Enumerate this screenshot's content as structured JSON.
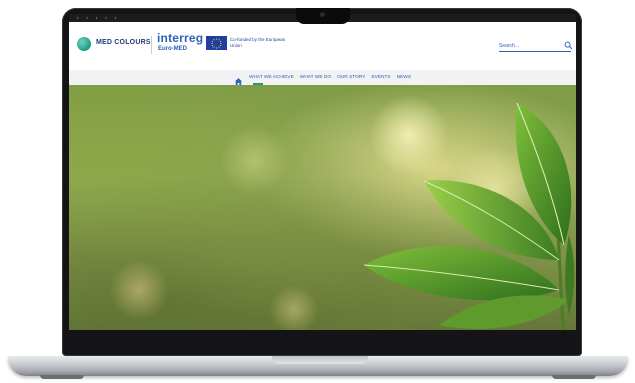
{
  "site": {
    "brand": "MED COLOURS",
    "program_name": "interreg",
    "program_sub": "Euro-MED",
    "eu_text": "Co-funded by the European Union"
  },
  "search": {
    "placeholder": "Search..."
  },
  "nav": {
    "items": [
      {
        "label": "WHAT WE ACHIEVE"
      },
      {
        "label": "WHAT WE DO"
      },
      {
        "label": "OUR STORY"
      },
      {
        "label": "EVENTS"
      },
      {
        "label": "NEWS"
      }
    ]
  },
  "colors": {
    "brand_blue": "#2a63b8",
    "brand_teal": "#1e9c86",
    "eu_blue": "#1f3fa3"
  },
  "icons": [
    "med-colours-logo-icon",
    "eu-flag-icon",
    "search-icon",
    "home-icon"
  ]
}
